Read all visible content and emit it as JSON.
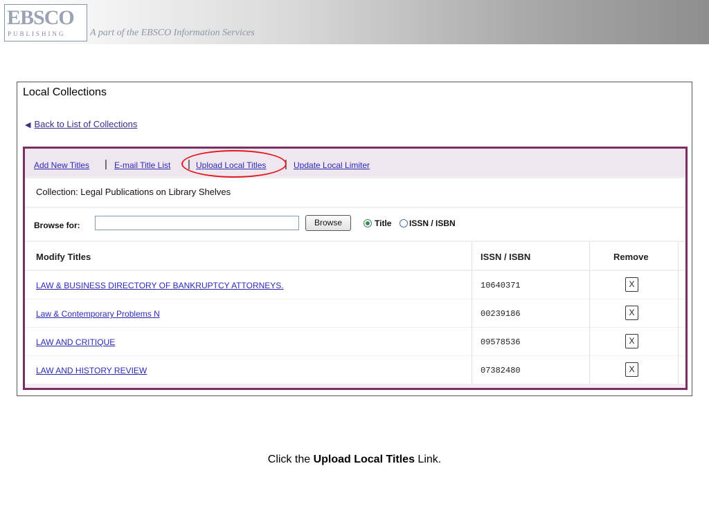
{
  "header": {
    "logo_text": "EBSCO",
    "logo_subtext": "PUBLISHING",
    "tagline": "A part of the EBSCO Information Services"
  },
  "panel": {
    "title": "Local Collections",
    "back_link": "Back to List of Collections",
    "toolbar": {
      "links": [
        "Add New Titles",
        "E-mail Title List",
        "Upload Local Titles",
        "Update Local Limiter"
      ],
      "separator": "|"
    },
    "collection_label": "Collection: Legal Publications on Library Shelves",
    "browse": {
      "label": "Browse for:",
      "input_value": "",
      "button_label": "Browse",
      "options": [
        "Title",
        "ISSN / ISBN"
      ],
      "selected_option": "Title"
    },
    "table": {
      "headers": [
        "Modify Titles",
        "ISSN / ISBN",
        "Remove"
      ],
      "rows": [
        {
          "title": "LAW & BUSINESS DIRECTORY OF BANKRUPTCY ATTORNEYS.",
          "issn": "10640371",
          "remove": "X"
        },
        {
          "title": "Law & Contemporary Problems N",
          "issn": "00239186",
          "remove": "X"
        },
        {
          "title": "LAW AND CRITIQUE",
          "issn": "09578536",
          "remove": "X"
        },
        {
          "title": "LAW AND HISTORY REVIEW",
          "issn": "07382480",
          "remove": "X"
        }
      ]
    }
  },
  "caption": {
    "prefix": "Click the ",
    "bold": "Upload Local Titles",
    "suffix": " Link."
  },
  "colors": {
    "accent_border": "#7a2f62",
    "link": "#2a2ab5",
    "highlight": "#e01a1a"
  }
}
